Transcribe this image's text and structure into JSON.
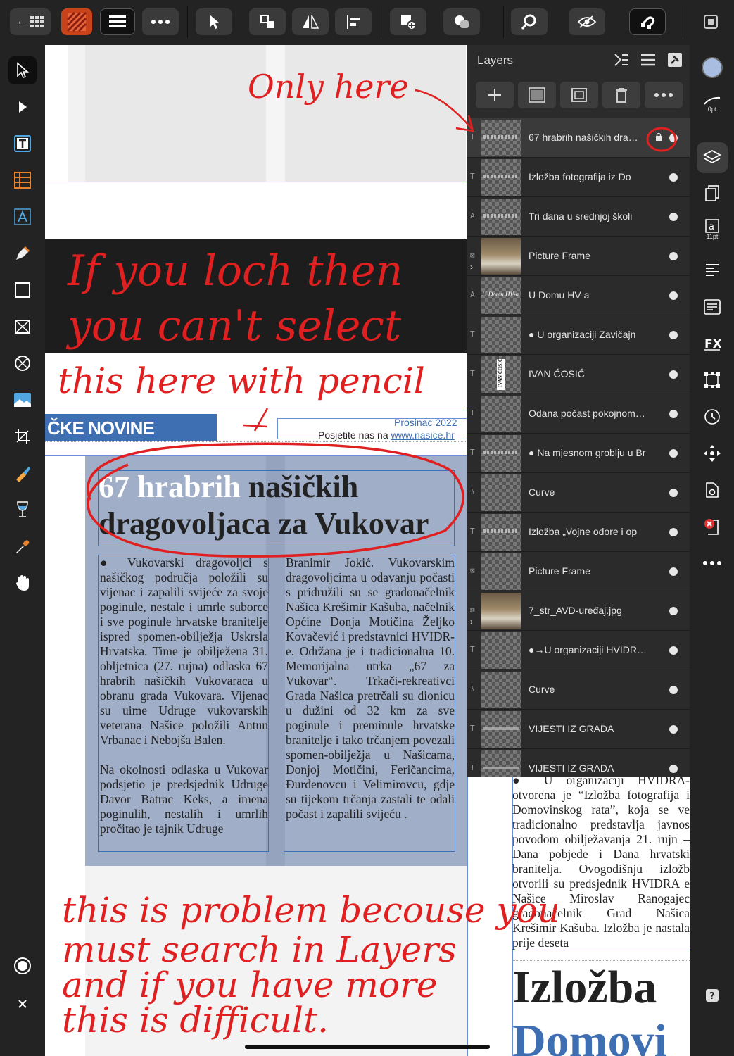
{
  "toolbar": {
    "back_label": "←",
    "grid_icon": "grid-icon",
    "icons": [
      "menu-icon",
      "more-icon",
      "move-tool-icon",
      "arrange-icon",
      "flip-icon",
      "align-icon",
      "insert-icon",
      "boolean-icon",
      "zoom-icon",
      "preview-icon",
      "snapping-icon",
      "export-icon"
    ]
  },
  "layers_panel": {
    "title": "Layers",
    "rows": [
      {
        "name": "67 hrabrih našičkih dra…",
        "type": "T",
        "thumb": "text",
        "locked": true
      },
      {
        "name": "Izložba fotografija iz Do",
        "type": "T",
        "thumb": "text"
      },
      {
        "name": "Tri dana u srednjoj školi",
        "type": "A",
        "thumb": "text"
      },
      {
        "name": "Picture Frame",
        "type": "⊠",
        "thumb": "photo",
        "expandable": true
      },
      {
        "name": "U Domu HV-a",
        "type": "A",
        "thumb": "label"
      },
      {
        "name": "● U organizaciji Zavičajn",
        "type": "T",
        "thumb": "empty"
      },
      {
        "name": "IVAN ĆOSIĆ",
        "type": "T",
        "thumb": "name"
      },
      {
        "name": "Odana počast pokojnom…",
        "type": "T",
        "thumb": "empty"
      },
      {
        "name": "● Na mjesnom groblju u Br",
        "type": "T",
        "thumb": "text"
      },
      {
        "name": "Curve",
        "type": "ʖ",
        "thumb": "empty"
      },
      {
        "name": "Izložba „Vojne odore i op",
        "type": "T",
        "thumb": "text"
      },
      {
        "name": "Picture Frame",
        "type": "⊠",
        "thumb": "empty"
      },
      {
        "name": "7_str_AVD-uređaj.jpg",
        "type": "⊠",
        "thumb": "photo",
        "expandable": true
      },
      {
        "name": "●→U organizaciji HVIDR…",
        "type": "T",
        "thumb": "empty"
      },
      {
        "name": "Curve",
        "type": "ʖ",
        "thumb": "empty"
      },
      {
        "name": "VIJESTI IZ GRADA",
        "type": "T",
        "thumb": "label2"
      },
      {
        "name": "VIJESTI IZ GRADA",
        "type": "T",
        "thumb": "label2"
      }
    ]
  },
  "right_bar": {
    "stroke_label": "0pt",
    "text_size_label": "11pt"
  },
  "page": {
    "masthead": "ČKE NOVINE",
    "date": "Prosinac 2022",
    "visit_prefix": "Posjetite nas na ",
    "visit_link": "www.nasice.hr",
    "headline_part1": "67 hrabrih ",
    "headline_part2": "našičkih",
    "headline_line2a": "dragovoljaca",
    "headline_line2b": " za Vukovar",
    "col1": "● Vukovarski dragovoljci s našičkog područja položili su vijenac i zapalili svijeće za svoje poginule, nestale i umrle suborce i sve poginule hrvatske branitelje ispred spomen-obilježja Uskrsla Hrvatska. Time je obilježena 31. obljetnica (27. rujna) odlaska 67 hrabrih našičkih Vukovaraca u obranu grada Vukovara. Vijenac su uime Udruge vukovarskih veterana Našice položili Antun Vrbanac i Nebojša Balen.",
    "col1b": "Na okolnosti odlaska u Vukovar podsjetio je predsjednik Udruge Davor Batrac Keks, a imena poginulih, nestalih i umrlih pročitao je tajnik Udruge",
    "col2": "Branimir Jokić. Vukovarskim dragovoljcima u odavanju počasti s pridružili su se gradonačelnik Našica Krešimir Kašuba, načelnik Općine Donja Motičina Željko Kovačević i predstavnici HVIDR-e. Održana je i tradicionalna 10. Memorijalna utrka „67 za Vukovar“. Trkači-rekreativci Grada Našica pretrčali su dionicu u dužini od 32 km za sve poginule i preminule hrvatske branitelje i tako trčanjem povezali spomen-obilježja u Našicama, Donjoj Motičini, Feričancima, Đurđenovcu i Velimirovcu, gdje su tijekom trčanja zastali te odali počast i zapalili svijeću .",
    "right_col": "● U organizaciji HVIDRA-otvorena je “Izložba fotografija i Domovinskog rata”, koja se ve tradicionalno predstavlja javnos povodom obilježavanja 21. rujn – Dana pobjede i Dana hrvatski branitelja. Ovogodišnju izložb otvorili su predsjednik HVIDRA e Našice Miroslav Ranogajec gradonačelnik Grad Našica Krešimir Kašuba. Izložba je nastala prije deseta",
    "big_title1": "Izložba",
    "big_title2": "Domovi",
    "thumb_name_label": "IVAN ĆOSIĆ",
    "thumb_domu_label": "U Domu HV-a"
  },
  "annotations": {
    "only_here": "Only here",
    "if_lock_1": "If you loch then",
    "if_lock_2": "you can't select",
    "this_here": "this here with pencil",
    "problem_1": "this is problem becouse you",
    "problem_2": "must search in Layers",
    "problem_3": "and if you have more",
    "problem_4": "this is difficult."
  }
}
